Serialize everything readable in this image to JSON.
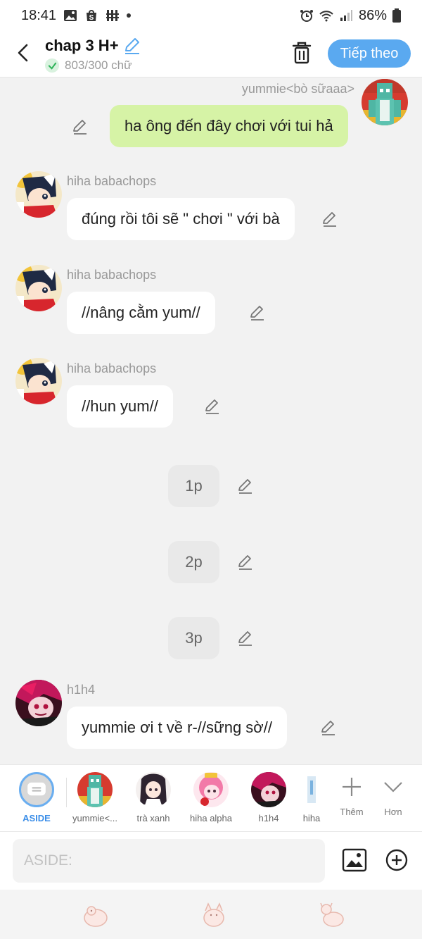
{
  "status": {
    "time": "18:41",
    "battery": "86%"
  },
  "header": {
    "title": "chap 3 H+",
    "word_count": "803/300 chữ",
    "next_label": "Tiếp theo"
  },
  "messages": [
    {
      "sender": "yummie<bò sữaaa>",
      "text": "ha ông đến đây chơi với tui hả",
      "mine": true
    },
    {
      "sender": "hiha babachops",
      "text": "đúng rồi tôi sẽ \" chơi \" với bà"
    },
    {
      "sender": "hiha babachops",
      "text": "//nâng cằm yum//"
    },
    {
      "sender": "hiha babachops",
      "text": "//hun yum//"
    },
    {
      "text": "1p",
      "narration": true
    },
    {
      "text": "2p",
      "narration": true
    },
    {
      "text": "3p",
      "narration": true
    },
    {
      "sender": "h1h4",
      "text": "yummie ơi t về r-//sững sờ//"
    }
  ],
  "characters": [
    {
      "label": "ASIDE"
    },
    {
      "label": "yummie<..."
    },
    {
      "label": "trà xanh"
    },
    {
      "label": "hiha alpha"
    },
    {
      "label": "h1h4"
    },
    {
      "label": "hiha"
    }
  ],
  "tools": {
    "add_label": "Thêm",
    "more_label": "Hơn"
  },
  "input": {
    "placeholder": "ASIDE:"
  },
  "colors": {
    "accent": "#5aa9f0",
    "my_bubble": "#d6f3a6",
    "other_bubble": "#ffffff",
    "narration_bubble": "#e9e9e9"
  }
}
